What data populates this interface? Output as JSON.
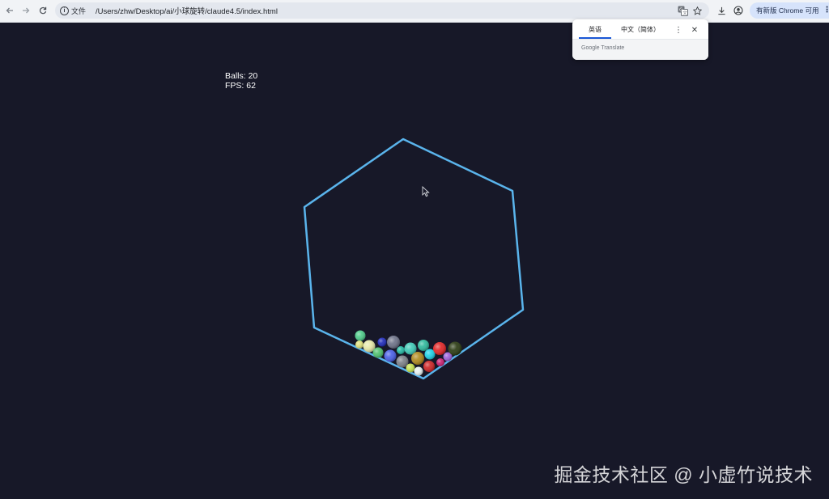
{
  "browser": {
    "site_info_label": "文件",
    "url": "/Users/zhw/Desktop/ai/小球旋转/claude4.5/index.html",
    "update_chip_label": "有新版 Chrome 可用"
  },
  "translate_popup": {
    "source_language_tab": "英语",
    "target_language_tab": "中文（简体）",
    "brand": "Google Translate"
  },
  "simulation": {
    "balls_label": "Balls: 20",
    "fps_label": "FPS: 62",
    "hexagon_color": "#5ab4ec",
    "background_color": "#171828"
  },
  "watermark": "掘金技术社区 @ 小虚竹说技术",
  "balls": [
    {
      "color": "#4ecb8a"
    },
    {
      "color": "#dfe07a"
    },
    {
      "color": "#e6e8a8"
    },
    {
      "color": "#1f2bb8"
    },
    {
      "color": "#4fc06e"
    },
    {
      "color": "#6d7288"
    },
    {
      "color": "#4a5fe6"
    },
    {
      "color": "#25b8a3"
    },
    {
      "color": "#7b7f87"
    },
    {
      "color": "#3fc9b6"
    },
    {
      "color": "#2fb89c"
    },
    {
      "color": "#b08a1e"
    },
    {
      "color": "#1fd0e6"
    },
    {
      "color": "#c4e050"
    },
    {
      "color": "#e6f0ef"
    },
    {
      "color": "#e02626"
    },
    {
      "color": "#cc2525"
    },
    {
      "color": "#9b60d8"
    },
    {
      "color": "#c81f6e"
    },
    {
      "color": "#2a3a12"
    }
  ]
}
